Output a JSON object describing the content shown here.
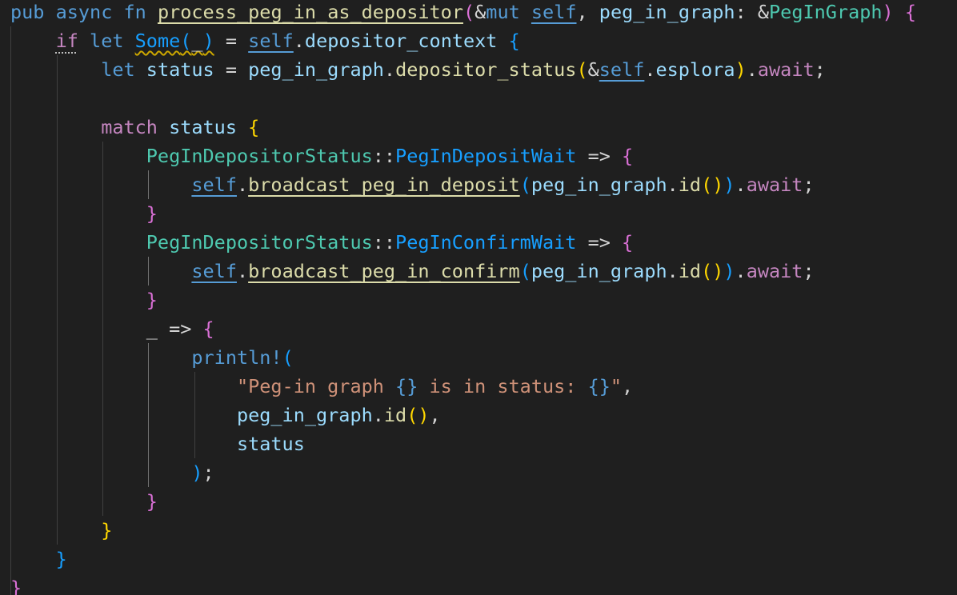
{
  "editor": {
    "language": "rust",
    "theme_background": "#1f1f1f",
    "lines": [
      [
        {
          "t": "pub",
          "c": "kw"
        },
        {
          "t": " ",
          "c": "punc"
        },
        {
          "t": "async",
          "c": "kw"
        },
        {
          "t": " ",
          "c": "punc"
        },
        {
          "t": "fn",
          "c": "kw"
        },
        {
          "t": " ",
          "c": "punc"
        },
        {
          "t": "process_peg_in_as_depositor",
          "c": "fn u"
        },
        {
          "t": "(",
          "c": "b2"
        },
        {
          "t": "&",
          "c": "punc"
        },
        {
          "t": "mut",
          "c": "kw"
        },
        {
          "t": " ",
          "c": "punc"
        },
        {
          "t": "self",
          "c": "kw u"
        },
        {
          "t": ", ",
          "c": "punc"
        },
        {
          "t": "peg_in_graph",
          "c": "var"
        },
        {
          "t": ": &",
          "c": "punc"
        },
        {
          "t": "PegInGraph",
          "c": "type"
        },
        {
          "t": ")",
          "c": "b2"
        },
        {
          "t": " ",
          "c": "punc"
        },
        {
          "t": "{",
          "c": "b2"
        }
      ],
      [
        {
          "t": "    ",
          "c": "punc"
        },
        {
          "t": "if",
          "c": "kw2 dots"
        },
        {
          "t": " ",
          "c": "punc"
        },
        {
          "t": "let",
          "c": "kw"
        },
        {
          "t": " ",
          "c": "punc"
        },
        {
          "t": "Some",
          "c": "b3 squig u"
        },
        {
          "t": "(",
          "c": "b3 squig"
        },
        {
          "t": "_",
          "c": "punc squig"
        },
        {
          "t": ")",
          "c": "b3 squig"
        },
        {
          "t": " = ",
          "c": "punc"
        },
        {
          "t": "self",
          "c": "kw u"
        },
        {
          "t": ".",
          "c": "punc"
        },
        {
          "t": "depositor_context",
          "c": "var"
        },
        {
          "t": " ",
          "c": "punc"
        },
        {
          "t": "{",
          "c": "b3"
        }
      ],
      [
        {
          "t": "        ",
          "c": "punc"
        },
        {
          "t": "let",
          "c": "kw"
        },
        {
          "t": " ",
          "c": "punc"
        },
        {
          "t": "status",
          "c": "var"
        },
        {
          "t": " = ",
          "c": "punc"
        },
        {
          "t": "peg_in_graph",
          "c": "var"
        },
        {
          "t": ".",
          "c": "punc"
        },
        {
          "t": "depositor_status",
          "c": "fn"
        },
        {
          "t": "(",
          "c": "b1"
        },
        {
          "t": "&",
          "c": "punc"
        },
        {
          "t": "self",
          "c": "kw u"
        },
        {
          "t": ".",
          "c": "punc"
        },
        {
          "t": "esplora",
          "c": "var"
        },
        {
          "t": ")",
          "c": "b1"
        },
        {
          "t": ".",
          "c": "punc"
        },
        {
          "t": "await",
          "c": "kw2"
        },
        {
          "t": ";",
          "c": "punc"
        }
      ],
      [],
      [
        {
          "t": "        ",
          "c": "punc"
        },
        {
          "t": "match",
          "c": "kw2"
        },
        {
          "t": " ",
          "c": "punc"
        },
        {
          "t": "status",
          "c": "var"
        },
        {
          "t": " ",
          "c": "punc"
        },
        {
          "t": "{",
          "c": "b1"
        }
      ],
      [
        {
          "t": "            ",
          "c": "punc"
        },
        {
          "t": "PegInDepositorStatus",
          "c": "type"
        },
        {
          "t": "::",
          "c": "punc"
        },
        {
          "t": "PegInDepositWait",
          "c": "b3"
        },
        {
          "t": " => ",
          "c": "punc"
        },
        {
          "t": "{",
          "c": "b2"
        }
      ],
      [
        {
          "t": "                ",
          "c": "punc"
        },
        {
          "t": "self",
          "c": "kw u"
        },
        {
          "t": ".",
          "c": "punc"
        },
        {
          "t": "broadcast_peg_in_deposit",
          "c": "fn u"
        },
        {
          "t": "(",
          "c": "b3"
        },
        {
          "t": "peg_in_graph",
          "c": "var"
        },
        {
          "t": ".",
          "c": "punc"
        },
        {
          "t": "id",
          "c": "fn"
        },
        {
          "t": "()",
          "c": "b1"
        },
        {
          "t": ")",
          "c": "b3"
        },
        {
          "t": ".",
          "c": "punc"
        },
        {
          "t": "await",
          "c": "kw2"
        },
        {
          "t": ";",
          "c": "punc"
        }
      ],
      [
        {
          "t": "            ",
          "c": "punc"
        },
        {
          "t": "}",
          "c": "b2"
        }
      ],
      [
        {
          "t": "            ",
          "c": "punc"
        },
        {
          "t": "PegInDepositorStatus",
          "c": "type"
        },
        {
          "t": "::",
          "c": "punc"
        },
        {
          "t": "PegInConfirmWait",
          "c": "b3"
        },
        {
          "t": " => ",
          "c": "punc"
        },
        {
          "t": "{",
          "c": "b2"
        }
      ],
      [
        {
          "t": "                ",
          "c": "punc"
        },
        {
          "t": "self",
          "c": "kw u"
        },
        {
          "t": ".",
          "c": "punc"
        },
        {
          "t": "broadcast_peg_in_confirm",
          "c": "fn u"
        },
        {
          "t": "(",
          "c": "b3"
        },
        {
          "t": "peg_in_graph",
          "c": "var"
        },
        {
          "t": ".",
          "c": "punc"
        },
        {
          "t": "id",
          "c": "fn"
        },
        {
          "t": "()",
          "c": "b1"
        },
        {
          "t": ")",
          "c": "b3"
        },
        {
          "t": ".",
          "c": "punc"
        },
        {
          "t": "await",
          "c": "kw2"
        },
        {
          "t": ";",
          "c": "punc"
        }
      ],
      [
        {
          "t": "            ",
          "c": "punc"
        },
        {
          "t": "}",
          "c": "b2"
        }
      ],
      [
        {
          "t": "            ",
          "c": "punc"
        },
        {
          "t": "_",
          "c": "punc"
        },
        {
          "t": " => ",
          "c": "punc"
        },
        {
          "t": "{",
          "c": "b2"
        }
      ],
      [
        {
          "t": "                ",
          "c": "punc"
        },
        {
          "t": "println!",
          "c": "mac"
        },
        {
          "t": "(",
          "c": "b3"
        }
      ],
      [
        {
          "t": "                    ",
          "c": "punc"
        },
        {
          "t": "\"Peg-in graph ",
          "c": "str"
        },
        {
          "t": "{}",
          "c": "kw"
        },
        {
          "t": " is in status: ",
          "c": "str"
        },
        {
          "t": "{}",
          "c": "kw"
        },
        {
          "t": "\"",
          "c": "str"
        },
        {
          "t": ",",
          "c": "punc"
        }
      ],
      [
        {
          "t": "                    ",
          "c": "punc"
        },
        {
          "t": "peg_in_graph",
          "c": "var"
        },
        {
          "t": ".",
          "c": "punc"
        },
        {
          "t": "id",
          "c": "fn"
        },
        {
          "t": "()",
          "c": "b1"
        },
        {
          "t": ",",
          "c": "punc"
        }
      ],
      [
        {
          "t": "                    ",
          "c": "punc"
        },
        {
          "t": "status",
          "c": "var"
        }
      ],
      [
        {
          "t": "                ",
          "c": "punc"
        },
        {
          "t": ")",
          "c": "b3"
        },
        {
          "t": ";",
          "c": "punc"
        }
      ],
      [
        {
          "t": "            ",
          "c": "punc"
        },
        {
          "t": "}",
          "c": "b2"
        }
      ],
      [
        {
          "t": "        ",
          "c": "punc"
        },
        {
          "t": "}",
          "c": "b1"
        }
      ],
      [
        {
          "t": "    ",
          "c": "punc"
        },
        {
          "t": "}",
          "c": "b3"
        }
      ],
      [
        {
          "t": "}",
          "c": "b2"
        }
      ]
    ]
  }
}
